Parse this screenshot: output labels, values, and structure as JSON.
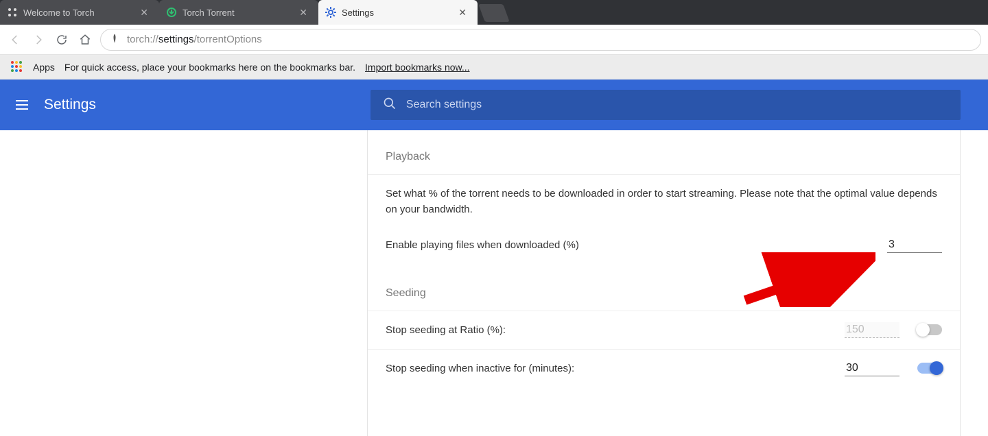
{
  "tabs": [
    {
      "title": "Welcome to Torch"
    },
    {
      "title": "Torch Torrent"
    },
    {
      "title": "Settings"
    }
  ],
  "omnibox": {
    "url_scheme": "torch://",
    "url_page": "settings",
    "url_path": "/torrentOptions"
  },
  "bookmark_bar": {
    "apps_label": "Apps",
    "hint": "For quick access, place your bookmarks here on the bookmarks bar.",
    "import_link": "Import bookmarks now..."
  },
  "settings_header": {
    "title": "Settings",
    "search_placeholder": "Search settings"
  },
  "playback": {
    "section_title": "Playback",
    "description": "Set what % of the torrent needs to be downloaded in order to start streaming. Please note that the optimal value depends on your bandwidth.",
    "enable_label": "Enable playing files when downloaded (%)",
    "enable_value": "3"
  },
  "seeding": {
    "section_title": "Seeding",
    "stop_ratio_label": "Stop seeding at Ratio (%):",
    "stop_ratio_value": "150",
    "stop_ratio_enabled": false,
    "stop_inactive_label": "Stop seeding when inactive for (minutes):",
    "stop_inactive_value": "30",
    "stop_inactive_enabled": true
  }
}
